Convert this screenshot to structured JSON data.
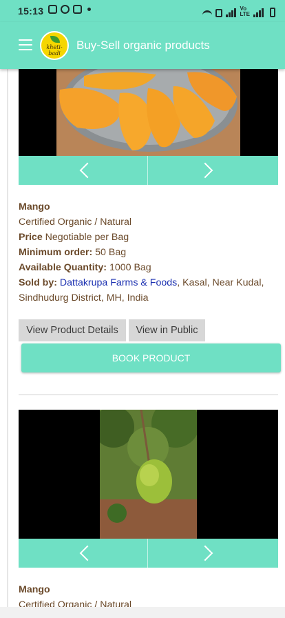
{
  "status_bar": {
    "time": "15:13",
    "left_icons": [
      "gallery-icon",
      "whatsapp-icon",
      "gmail-icon",
      "dot-icon"
    ],
    "right_icons": [
      "wifi-icon",
      "call-icon",
      "signal-icon",
      "volte-icon",
      "signal-icon",
      "battery-icon"
    ]
  },
  "app_bar": {
    "logo_text": "kheti-badi",
    "title": "Buy-Sell organic products"
  },
  "colors": {
    "accent": "#6fe0c4",
    "text_brown": "#6b4a2b",
    "seller_link": "#1a2fb0",
    "grey_button": "#d7d7d7"
  },
  "products": [
    {
      "name": "Mango",
      "certification": "Certified Organic / Natural",
      "price_label": "Price",
      "price_value": "Negotiable per Bag",
      "min_order_label": "Minimum order:",
      "min_order_value": "50 Bag",
      "qty_label": "Available Quantity:",
      "qty_value": "1000 Bag",
      "sold_by_label": "Sold by:",
      "seller": "Dattakrupa Farms & Foods",
      "location_line1": ", Kasal, Near Kudal,",
      "location_line2": "Sindhudurg District, MH, India",
      "view_details_label": "View Product Details",
      "view_public_label": "View in Public",
      "book_label": "BOOK PRODUCT"
    },
    {
      "name": "Mango",
      "certification": "Certified Organic / Natural"
    }
  ]
}
